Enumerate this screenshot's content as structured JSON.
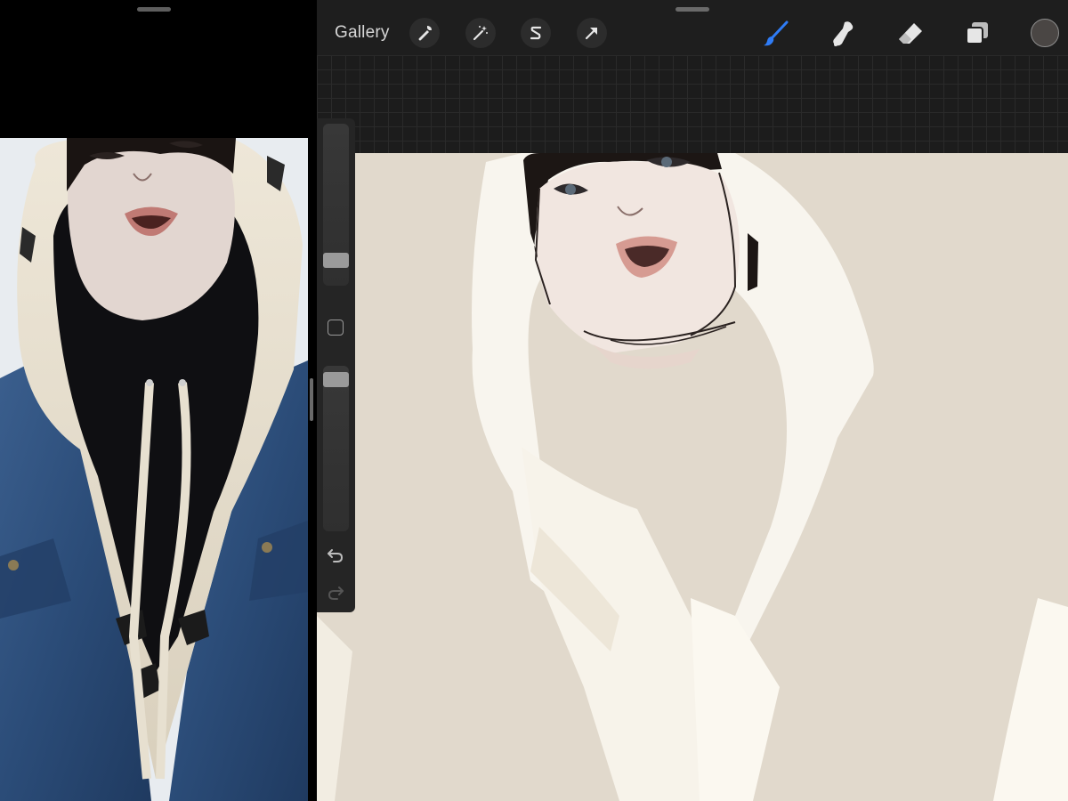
{
  "toolbar": {
    "gallery_label": "Gallery",
    "left_tools": [
      "wrench-icon",
      "magic-wand-icon",
      "selection-s-icon",
      "arrow-transform-icon"
    ],
    "right_tools": [
      "brush-icon",
      "smudge-icon",
      "eraser-icon",
      "layers-icon"
    ],
    "active_tool": "brush-icon",
    "active_color": "#4a4644",
    "accent_color": "#2f7cf6"
  },
  "sidebar": {
    "brush_size_level": 0.12,
    "opacity_level": 0.96,
    "controls": [
      "modify-button",
      "undo-icon",
      "redo-icon"
    ]
  },
  "canvas": {
    "background_color": "#e1d9cc"
  }
}
